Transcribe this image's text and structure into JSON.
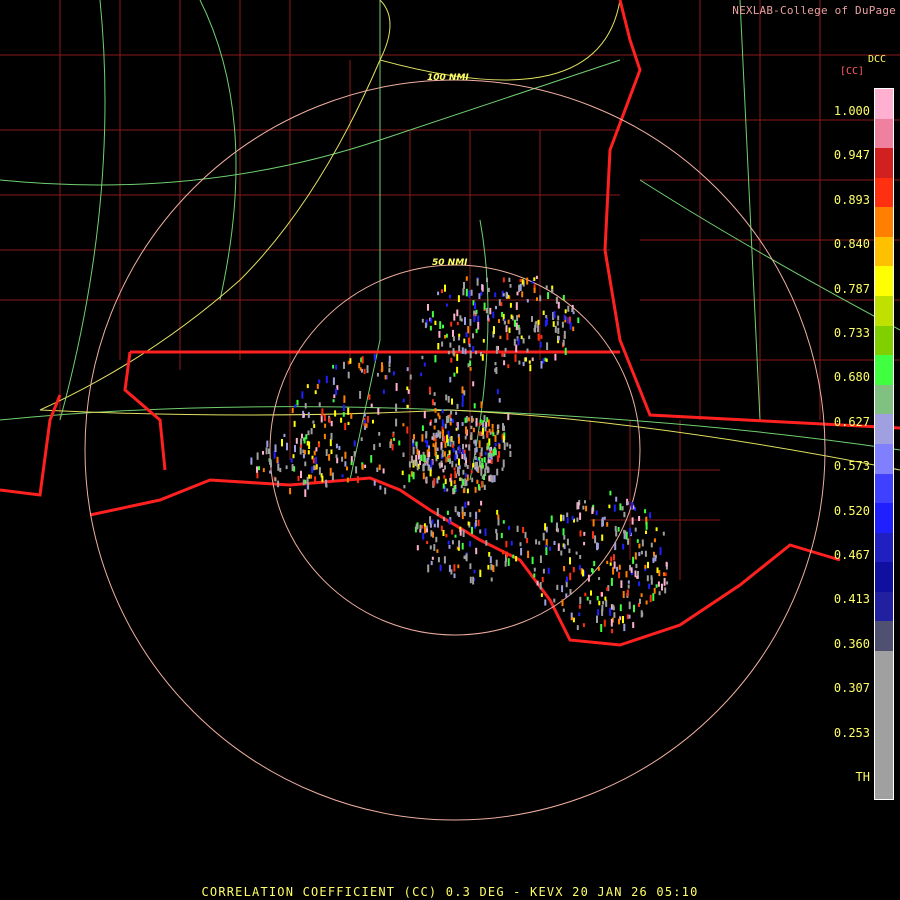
{
  "credit": "NEXLAB-College of DuPage",
  "site_code": "DCC",
  "units": "[CC]",
  "rings": [
    {
      "label": "50 NMI"
    },
    {
      "label": "100 NMI"
    }
  ],
  "colorbar": {
    "ticks": [
      "1.000",
      "0.947",
      "0.893",
      "0.840",
      "0.787",
      "0.733",
      "0.680",
      "0.627",
      "0.573",
      "0.520",
      "0.467",
      "0.413",
      "0.360",
      "0.307",
      "0.253",
      "TH"
    ],
    "colors": [
      "#ffb0d0",
      "#f080a0",
      "#d02020",
      "#ff3010",
      "#ff8000",
      "#ffc000",
      "#ffff00",
      "#c0e000",
      "#80d000",
      "#40ff40",
      "#80c080",
      "#a0a0e0",
      "#8080ff",
      "#4040ff",
      "#2020ff",
      "#2020c0",
      "#1010a0",
      "#2020a0",
      "#505070",
      "#a0a0a0",
      "#a0a0a0",
      "#a0a0a0",
      "#a0a0a0",
      "#a0a0a0"
    ]
  },
  "footer": "CORRELATION COEFFICIENT (CC) 0.3 DEG - KEVX 20 JAN 26 05:10"
}
